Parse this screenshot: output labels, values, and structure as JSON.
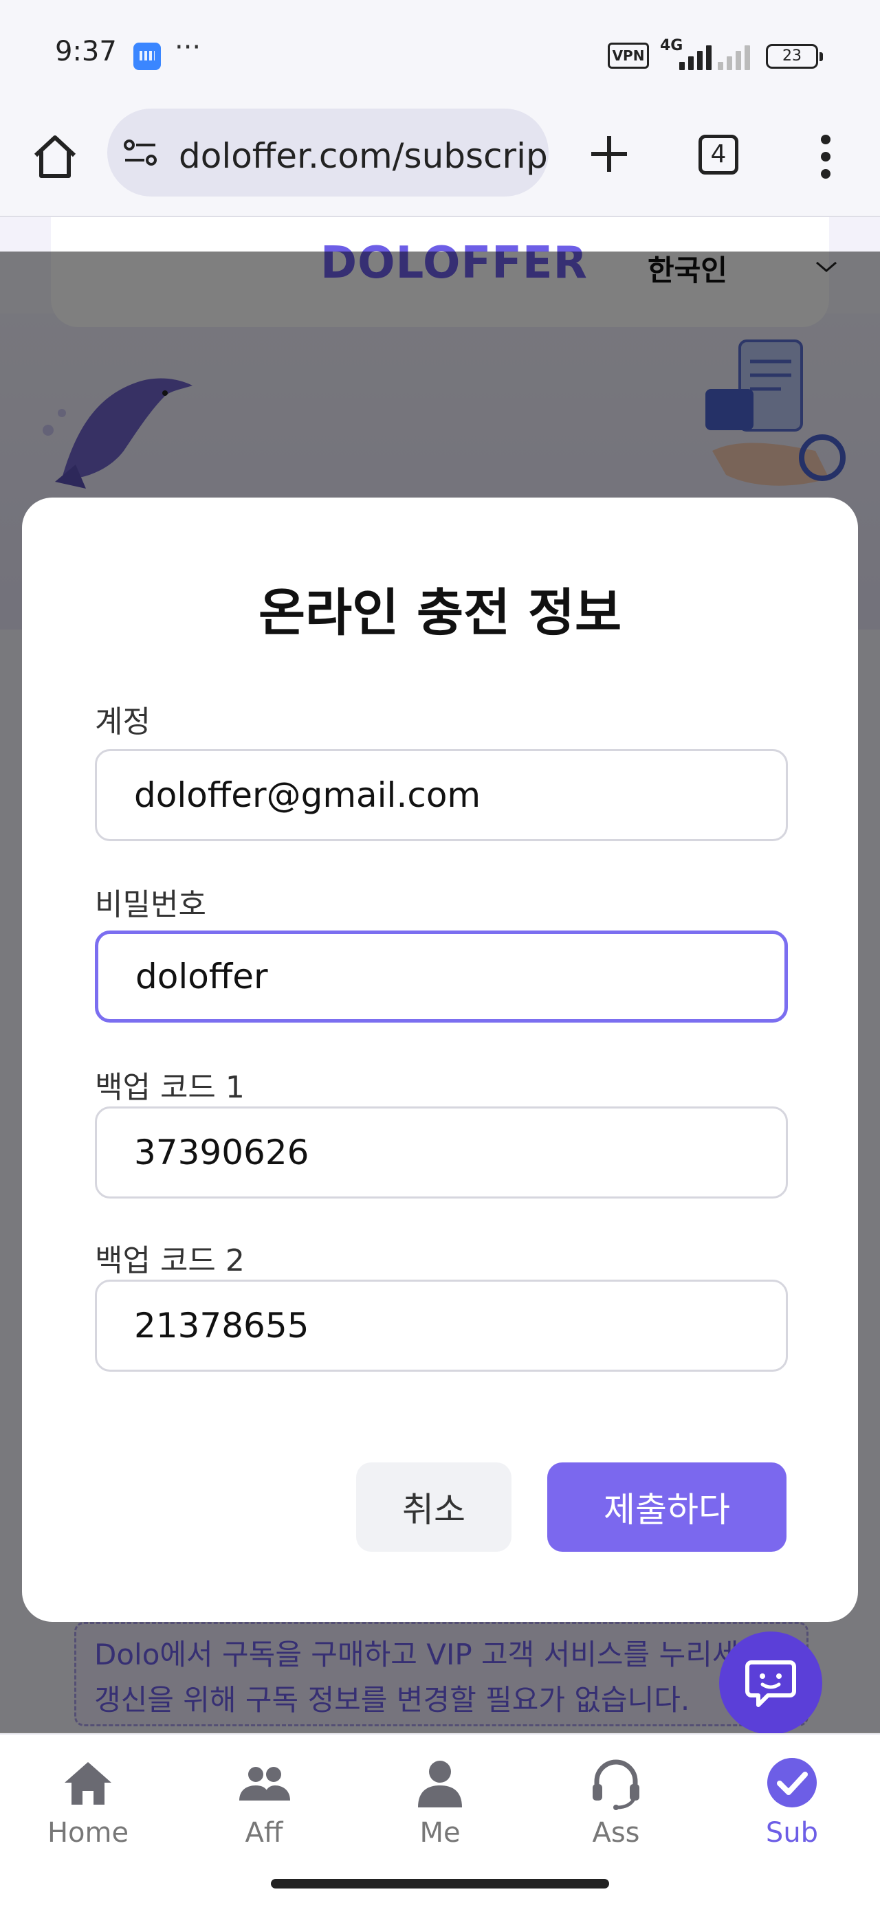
{
  "status_bar": {
    "time": "9:37",
    "dots": "···",
    "vpn": "VPN",
    "network": "4G",
    "battery": "23"
  },
  "browser": {
    "url": "doloffer.com/subscrip",
    "tab_count": "4"
  },
  "site": {
    "logo": "DOLOFFER",
    "language": "한국인",
    "promo_text": "Dolo에서 구독을 구매하고 VIP 고객 서비스를 누리세요. 갱신을 위해 구독 정보를 변경할 필요가 없습니다."
  },
  "modal": {
    "title": "온라인 충전 정보",
    "fields": [
      {
        "label": "계정",
        "value": "doloffer@gmail.com"
      },
      {
        "label": "비밀번호",
        "value": "doloffer"
      },
      {
        "label": "백업 코드 1",
        "value": "37390626"
      },
      {
        "label": "백업 코드 2",
        "value": "21378655"
      }
    ],
    "cancel_label": "취소",
    "submit_label": "제출하다"
  },
  "nav": {
    "items": [
      {
        "label": "Home",
        "icon": "home-icon"
      },
      {
        "label": "Aff",
        "icon": "users-icon"
      },
      {
        "label": "Me",
        "icon": "user-icon"
      },
      {
        "label": "Ass",
        "icon": "headset-icon"
      },
      {
        "label": "Sub",
        "icon": "check-circle-icon",
        "active": true
      }
    ]
  },
  "colors": {
    "accent": "#7b68ee",
    "focus_border": "#7b6ef0",
    "chat_fab": "#5b3fd8",
    "logo": "#6d5ee6"
  }
}
